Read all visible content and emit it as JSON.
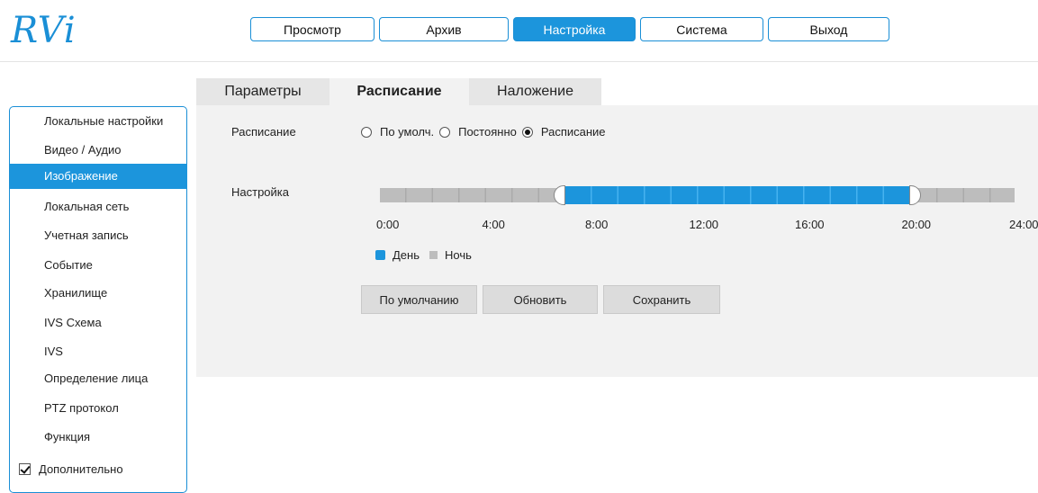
{
  "brand": {
    "logo_text": "RVi",
    "color": "#1a8fd6"
  },
  "topnav": [
    {
      "label": "Просмотр",
      "active": false
    },
    {
      "label": "Архив",
      "active": false
    },
    {
      "label": "Настройка",
      "active": true
    },
    {
      "label": "Система",
      "active": false
    },
    {
      "label": "Выход",
      "active": false
    }
  ],
  "sidebar": {
    "items": [
      {
        "label": "Локальные настройки",
        "active": false
      },
      {
        "label": "Видео / Аудио",
        "active": false
      },
      {
        "label": "Изображение",
        "active": true
      },
      {
        "label": "Локальная сеть",
        "active": false
      },
      {
        "label": "Учетная запись",
        "active": false
      },
      {
        "label": "Событие",
        "active": false
      },
      {
        "label": "Хранилище",
        "active": false
      },
      {
        "label": "IVS Схема",
        "active": false
      },
      {
        "label": "IVS",
        "active": false
      },
      {
        "label": "Определение лица",
        "active": false
      },
      {
        "label": "PTZ протокол",
        "active": false
      },
      {
        "label": "Функция",
        "active": false
      }
    ],
    "advanced_label": "Дополнительно",
    "advanced_checked": true
  },
  "tabs": [
    {
      "label": "Параметры",
      "active": false
    },
    {
      "label": "Расписание",
      "active": true
    },
    {
      "label": "Наложение",
      "active": false
    }
  ],
  "schedule": {
    "label": "Расписание",
    "options": [
      {
        "label": "По умолч.",
        "selected": false
      },
      {
        "label": "Постоянно",
        "selected": false
      },
      {
        "label": "Расписание",
        "selected": true
      }
    ]
  },
  "setting": {
    "label": "Настройка",
    "day_start_hour": 7,
    "day_end_hour": 20,
    "ticks": [
      "0:00",
      "4:00",
      "8:00",
      "12:00",
      "16:00",
      "20:00",
      "24:00"
    ],
    "legend": {
      "day": "День",
      "night": "Ночь"
    },
    "colors": {
      "day": "#1c95dc",
      "night": "#bdbdbd"
    }
  },
  "buttons": {
    "default": "По умолчанию",
    "refresh": "Обновить",
    "save": "Сохранить"
  }
}
